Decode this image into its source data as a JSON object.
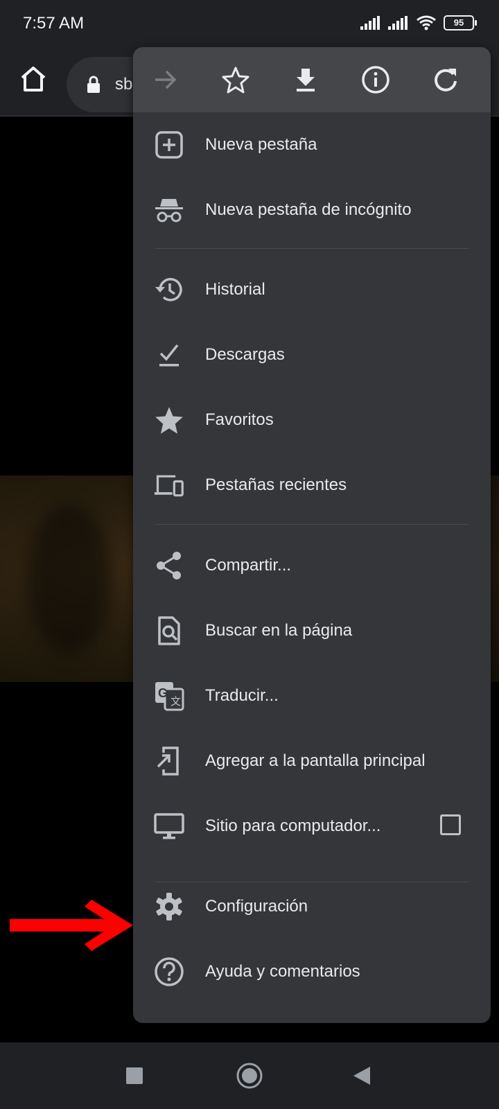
{
  "status_bar": {
    "time": "7:57 AM",
    "battery": "95",
    "icons": [
      "signal-icon",
      "signal-icon",
      "wifi-icon",
      "battery-icon"
    ]
  },
  "toolbar": {
    "url_text": "sb",
    "icons": [
      "home-icon",
      "lock-icon"
    ]
  },
  "menu": {
    "top_actions": [
      {
        "name": "forward",
        "icon": "arrow-right-icon"
      },
      {
        "name": "bookmark",
        "icon": "star-outline-icon"
      },
      {
        "name": "download-page",
        "icon": "download-icon"
      },
      {
        "name": "page-info",
        "icon": "info-icon"
      },
      {
        "name": "reload",
        "icon": "reload-icon"
      }
    ],
    "items": [
      {
        "label": "Nueva pestaña",
        "icon": "new-tab-icon"
      },
      {
        "label": "Nueva pestaña de incógnito",
        "icon": "incognito-icon"
      },
      {
        "label": "Historial",
        "icon": "history-icon"
      },
      {
        "label": "Descargas",
        "icon": "downloads-icon"
      },
      {
        "label": "Favoritos",
        "icon": "star-icon"
      },
      {
        "label": "Pestañas recientes",
        "icon": "devices-icon"
      },
      {
        "label": "Compartir...",
        "icon": "share-icon"
      },
      {
        "label": "Buscar en la página",
        "icon": "find-in-page-icon"
      },
      {
        "label": "Traducir...",
        "icon": "translate-icon"
      },
      {
        "label": "Agregar a la pantalla principal",
        "icon": "add-to-home-icon"
      },
      {
        "label": "Sitio para computador...",
        "icon": "desktop-icon",
        "checkbox": false
      },
      {
        "label": "Configuración",
        "icon": "gear-icon"
      },
      {
        "label": "Ayuda y comentarios",
        "icon": "help-icon"
      }
    ]
  },
  "annotation": {
    "color": "#ff0000",
    "icon": "red-arrow-icon"
  },
  "nav_bar": {
    "icons": [
      "recents-icon",
      "home-circle-icon",
      "back-icon"
    ]
  },
  "colors": {
    "menu_bg": "#35363a",
    "menu_top_bg": "#45464a",
    "toolbar_bg": "#202124",
    "text": "#e8eaed",
    "icon": "#bdc1c6"
  }
}
